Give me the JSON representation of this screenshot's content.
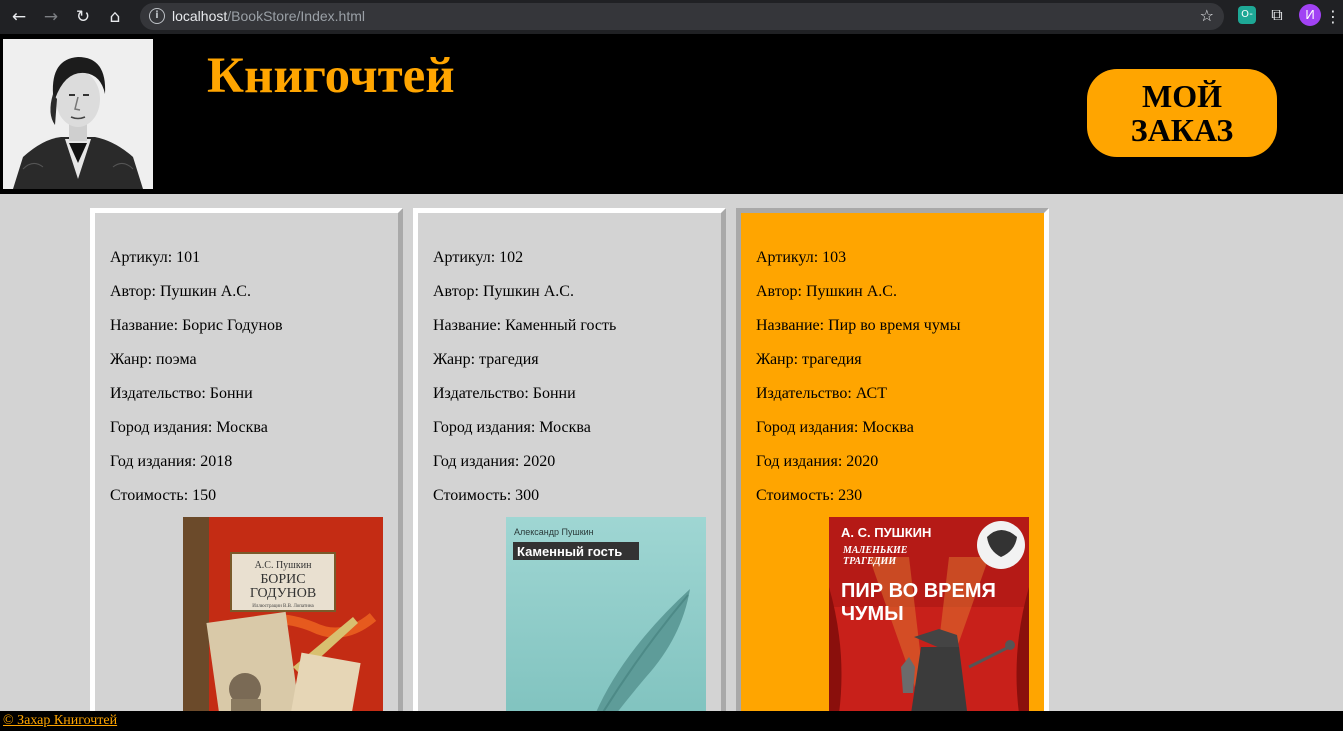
{
  "browser": {
    "url_host": "localhost",
    "url_path": "/BookStore/Index.html",
    "profile_initial": "И",
    "extension_label": "O-"
  },
  "site": {
    "title": "Книгочтей",
    "order_button_line1": "МОЙ",
    "order_button_line2": "ЗАКАЗ",
    "footer": "© Захар Книгочтей",
    "accent_color": "#ffa500"
  },
  "books": [
    {
      "article": "Артикул: 101",
      "author": "Автор: Пушкин А.С.",
      "name": "Название: Борис Годунов",
      "genre": "Жанр: поэма",
      "publisher": "Издательство: Бонни",
      "city": "Город издания: Москва",
      "year": "Год издания: 2018",
      "price": "Стоимость: 150",
      "cover": {
        "author": "А.С. Пушкин",
        "title_line1": "БОРИС",
        "title_line2": "ГОДУНОВ",
        "illustrator": "Иллюстрации В.В. Лопатина"
      }
    },
    {
      "article": "Артикул: 102",
      "author": "Автор: Пушкин А.С.",
      "name": "Название: Каменный гость",
      "genre": "Жанр: трагедия",
      "publisher": "Издательство: Бонни",
      "city": "Город издания: Москва",
      "year": "Год издания: 2020",
      "price": "Стоимость: 300",
      "cover": {
        "author": "Александр Пушкин",
        "title": "Каменный гость"
      }
    },
    {
      "article": "Артикул: 103",
      "author": "Автор: Пушкин А.С.",
      "name": "Название: Пир во время чумы",
      "genre": "Жанр: трагедия",
      "publisher": "Издательство: АСТ",
      "city": "Город издания: Москва",
      "year": "Год издания: 2020",
      "price": "Стоимость: 230",
      "cover": {
        "author": "А. С. ПУШКИН",
        "series_line1": "МАЛЕНЬКИЕ",
        "series_line2": "ТРАГЕДИИ",
        "title_line1": "ПИР ВО ВРЕМЯ",
        "title_line2": "ЧУМЫ"
      }
    }
  ]
}
